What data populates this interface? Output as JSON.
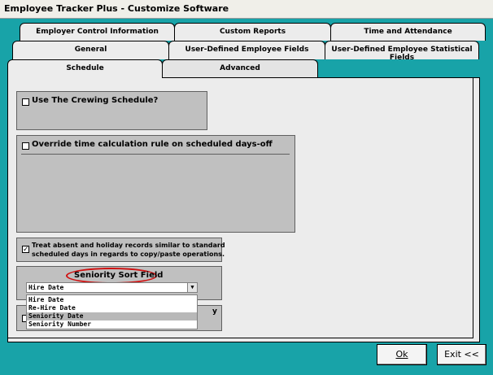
{
  "window": {
    "title": "Employee Tracker Plus - Customize Software"
  },
  "tabs": {
    "row1": [
      "Employer Control Information",
      "Custom Reports",
      "Time and Attendance"
    ],
    "row2": [
      "General",
      "User-Defined Employee Fields",
      "User-Defined Employee Statistical Fields"
    ],
    "row3": [
      "Schedule",
      "Advanced"
    ],
    "active": "Schedule"
  },
  "schedule": {
    "crewing_label": "Use The Crewing Schedule?",
    "crewing_checked": false,
    "override_label": "Override time calculation rule on scheduled days-off",
    "override_checked": false,
    "treat_absent_label_line1": "Treat absent and holiday records similar to standard",
    "treat_absent_label_line2": "scheduled days in regards to copy/paste operations.",
    "treat_absent_checked": true,
    "check_mark": "✓",
    "seniority_title": "Seniority Sort Field",
    "seniority_value": "Hire Date",
    "seniority_options": [
      "Hire Date",
      "Re-Hire Date",
      "Seniority Date",
      "Seniority Number"
    ],
    "highlighted_option": "Seniority Date",
    "hidden_partial_text": "y"
  },
  "buttons": {
    "ok": "Ok",
    "exit": "Exit <<"
  },
  "colors": {
    "background": "#18a3a8",
    "highlight_ellipse": "#d01010",
    "selected_row": "#b8b8b8"
  }
}
